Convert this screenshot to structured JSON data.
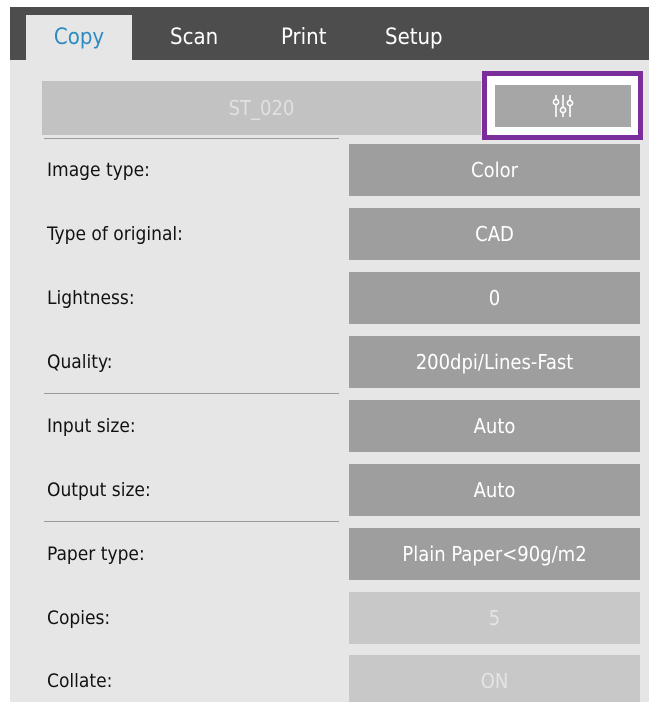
{
  "tabs": [
    {
      "label": "Copy",
      "active": true
    },
    {
      "label": "Scan",
      "active": false
    },
    {
      "label": "Print",
      "active": false
    },
    {
      "label": "Setup",
      "active": false
    }
  ],
  "preset": {
    "label": "ST_020"
  },
  "settings_button": {
    "icon": "sliders-icon",
    "highlight_color": "#7b2d9c"
  },
  "settings": [
    {
      "label": "Image type:",
      "value": "Color",
      "enabled": true
    },
    {
      "label": "Type of original:",
      "value": "CAD",
      "enabled": true
    },
    {
      "label": "Lightness:",
      "value": "0",
      "enabled": true
    },
    {
      "label": "Quality:",
      "value": "200dpi/Lines-Fast",
      "enabled": true
    },
    {
      "label": "Input size:",
      "value": "Auto",
      "enabled": true
    },
    {
      "label": "Output size:",
      "value": "Auto",
      "enabled": true
    },
    {
      "label": "Paper type:",
      "value": "Plain Paper<90g/m2",
      "enabled": true
    },
    {
      "label": "Copies:",
      "value": "5",
      "enabled": false
    },
    {
      "label": "Collate:",
      "value": "ON",
      "enabled": false
    }
  ],
  "colors": {
    "tab_bar": "#4d4d4d",
    "active_tab_text": "#2e8bc0",
    "panel": "#e6e6e6",
    "value_button": "#9e9e9e",
    "value_disabled": "#c8c8c8"
  }
}
